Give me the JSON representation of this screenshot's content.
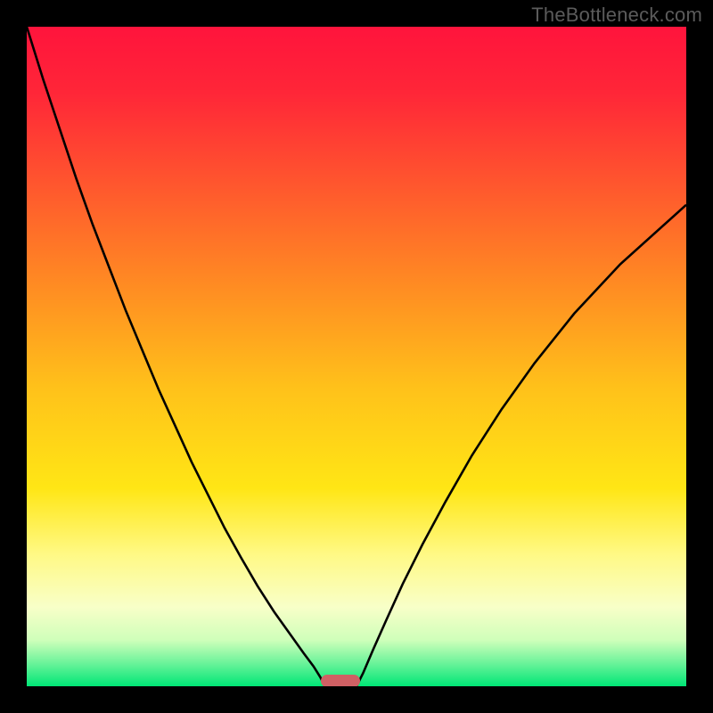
{
  "watermark": "TheBottleneck.com",
  "chart_data": {
    "type": "line",
    "title": "",
    "xlabel": "",
    "ylabel": "",
    "xlim": [
      0,
      1
    ],
    "ylim": [
      0,
      1
    ],
    "background_gradient": {
      "stops": [
        {
          "pos": 0.0,
          "color": "#ff143c"
        },
        {
          "pos": 0.1,
          "color": "#ff2638"
        },
        {
          "pos": 0.25,
          "color": "#ff5a2d"
        },
        {
          "pos": 0.4,
          "color": "#ff8e22"
        },
        {
          "pos": 0.55,
          "color": "#ffc21a"
        },
        {
          "pos": 0.7,
          "color": "#ffe615"
        },
        {
          "pos": 0.8,
          "color": "#fff985"
        },
        {
          "pos": 0.88,
          "color": "#f8ffc8"
        },
        {
          "pos": 0.93,
          "color": "#cfffba"
        },
        {
          "pos": 0.965,
          "color": "#6bf39a"
        },
        {
          "pos": 1.0,
          "color": "#00e676"
        }
      ]
    },
    "series": [
      {
        "name": "left-bottleneck-curve",
        "x": [
          0.0,
          0.025,
          0.05,
          0.075,
          0.1,
          0.125,
          0.15,
          0.175,
          0.2,
          0.225,
          0.25,
          0.275,
          0.3,
          0.325,
          0.35,
          0.375,
          0.4,
          0.42,
          0.435,
          0.445,
          0.452
        ],
        "y": [
          1.0,
          0.92,
          0.845,
          0.77,
          0.7,
          0.635,
          0.57,
          0.51,
          0.45,
          0.395,
          0.34,
          0.29,
          0.24,
          0.195,
          0.152,
          0.113,
          0.078,
          0.05,
          0.03,
          0.014,
          0.0
        ]
      },
      {
        "name": "right-bottleneck-curve",
        "x": [
          0.5,
          0.51,
          0.525,
          0.545,
          0.57,
          0.6,
          0.635,
          0.675,
          0.72,
          0.77,
          0.83,
          0.9,
          1.0
        ],
        "y": [
          0.0,
          0.02,
          0.055,
          0.1,
          0.155,
          0.215,
          0.28,
          0.35,
          0.42,
          0.49,
          0.565,
          0.64,
          0.73
        ]
      }
    ],
    "marker": {
      "x": 0.475,
      "y": 0.0075,
      "label": ""
    }
  }
}
